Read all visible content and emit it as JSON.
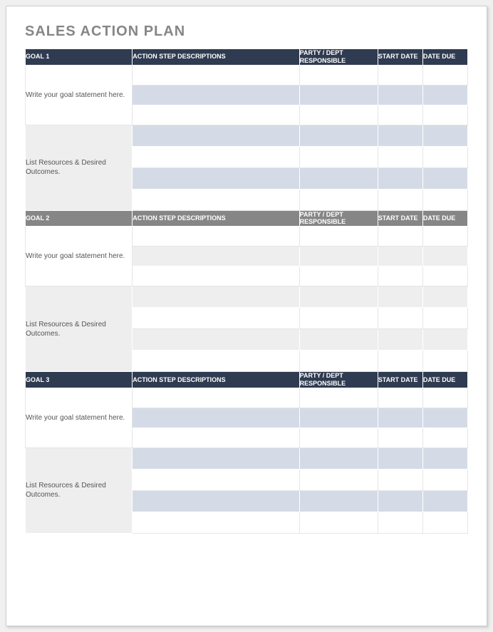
{
  "title": "SALES ACTION PLAN",
  "columns": {
    "action": "ACTION STEP DESCRIPTIONS",
    "party": "PARTY / DEPT RESPONSIBLE",
    "start": "START DATE",
    "due": "DATE DUE"
  },
  "goals": [
    {
      "label": "GOAL 1",
      "header_style": "dark",
      "statement_placeholder": "Write your goal statement here.",
      "resources_placeholder": "List Resources & Desired Outcomes."
    },
    {
      "label": "GOAL 2",
      "header_style": "grey",
      "statement_placeholder": "Write your goal statement here.",
      "resources_placeholder": "List Resources & Desired Outcomes."
    },
    {
      "label": "GOAL 3",
      "header_style": "dark",
      "statement_placeholder": "Write your goal statement here.",
      "resources_placeholder": "List Resources & Desired Outcomes."
    }
  ]
}
